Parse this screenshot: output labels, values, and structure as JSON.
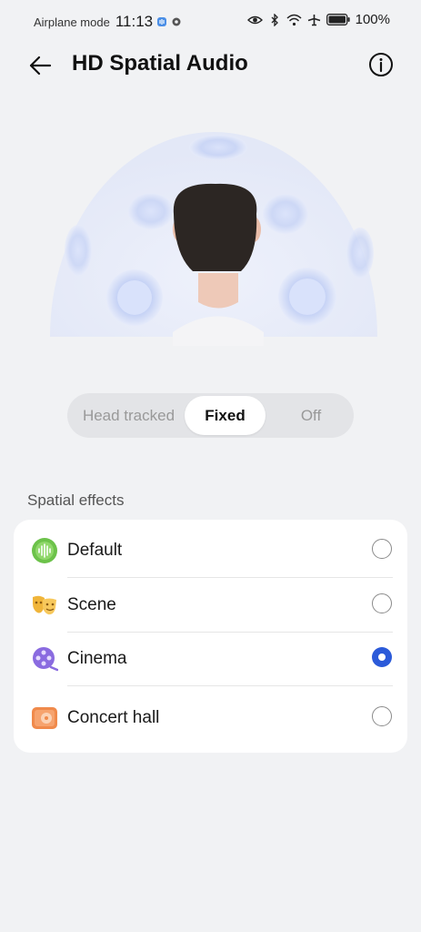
{
  "status_bar": {
    "mode_text": "Airplane mode",
    "time": "11:13",
    "battery": "100%"
  },
  "header": {
    "title": "HD Spatial Audio"
  },
  "mode_switch": {
    "options": [
      "Head tracked",
      "Fixed",
      "Off"
    ],
    "selected": "Fixed"
  },
  "effects": {
    "section_title": "Spatial effects",
    "items": [
      {
        "label": "Default",
        "icon": "soundwave-icon",
        "color": "#6cc24a",
        "selected": false
      },
      {
        "label": "Scene",
        "icon": "theater-masks-icon",
        "color": "#f0b53a",
        "selected": false
      },
      {
        "label": "Cinema",
        "icon": "film-reel-icon",
        "color": "#8a6be0",
        "selected": true
      },
      {
        "label": "Concert hall",
        "icon": "concert-icon",
        "color": "#f08a4b",
        "selected": false
      }
    ]
  },
  "colors": {
    "accent": "#2b5ad9",
    "background": "#f1f2f4"
  }
}
